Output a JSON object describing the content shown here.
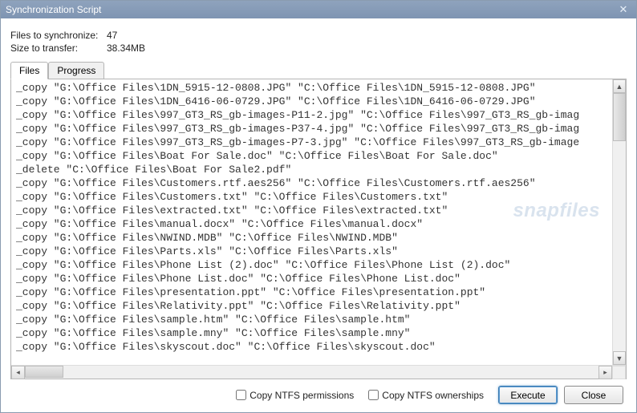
{
  "window": {
    "title": "Synchronization Script"
  },
  "info": {
    "files_label": "Files to synchronize:",
    "files_value": "47",
    "size_label": "Size to transfer:",
    "size_value": "38.34MB"
  },
  "tabs": {
    "files": "Files",
    "progress": "Progress"
  },
  "watermark": "snapfiles",
  "lines": [
    "_copy \"G:\\Office Files\\1DN_5915-12-0808.JPG\" \"C:\\Office Files\\1DN_5915-12-0808.JPG\"",
    "_copy \"G:\\Office Files\\1DN_6416-06-0729.JPG\" \"C:\\Office Files\\1DN_6416-06-0729.JPG\"",
    "_copy \"G:\\Office Files\\997_GT3_RS_gb-images-P11-2.jpg\" \"C:\\Office Files\\997_GT3_RS_gb-imag",
    "_copy \"G:\\Office Files\\997_GT3_RS_gb-images-P37-4.jpg\" \"C:\\Office Files\\997_GT3_RS_gb-imag",
    "_copy \"G:\\Office Files\\997_GT3_RS_gb-images-P7-3.jpg\" \"C:\\Office Files\\997_GT3_RS_gb-image",
    "_copy \"G:\\Office Files\\Boat For Sale.doc\" \"C:\\Office Files\\Boat For Sale.doc\"",
    "_delete \"C:\\Office Files\\Boat For Sale2.pdf\"",
    "_copy \"G:\\Office Files\\Customers.rtf.aes256\" \"C:\\Office Files\\Customers.rtf.aes256\"",
    "_copy \"G:\\Office Files\\Customers.txt\" \"C:\\Office Files\\Customers.txt\"",
    "_copy \"G:\\Office Files\\extracted.txt\" \"C:\\Office Files\\extracted.txt\"",
    "_copy \"G:\\Office Files\\manual.docx\" \"C:\\Office Files\\manual.docx\"",
    "_copy \"G:\\Office Files\\NWIND.MDB\" \"C:\\Office Files\\NWIND.MDB\"",
    "_copy \"G:\\Office Files\\Parts.xls\" \"C:\\Office Files\\Parts.xls\"",
    "_copy \"G:\\Office Files\\Phone List (2).doc\" \"C:\\Office Files\\Phone List (2).doc\"",
    "_copy \"G:\\Office Files\\Phone List.doc\" \"C:\\Office Files\\Phone List.doc\"",
    "_copy \"G:\\Office Files\\presentation.ppt\" \"C:\\Office Files\\presentation.ppt\"",
    "_copy \"G:\\Office Files\\Relativity.ppt\" \"C:\\Office Files\\Relativity.ppt\"",
    "_copy \"G:\\Office Files\\sample.htm\" \"C:\\Office Files\\sample.htm\"",
    "_copy \"G:\\Office Files\\sample.mny\" \"C:\\Office Files\\sample.mny\"",
    "_copy \"G:\\Office Files\\skyscout.doc\" \"C:\\Office Files\\skyscout.doc\""
  ],
  "footer": {
    "copy_perms": "Copy NTFS permissions",
    "copy_owners": "Copy NTFS ownerships",
    "execute": "Execute",
    "close": "Close"
  }
}
